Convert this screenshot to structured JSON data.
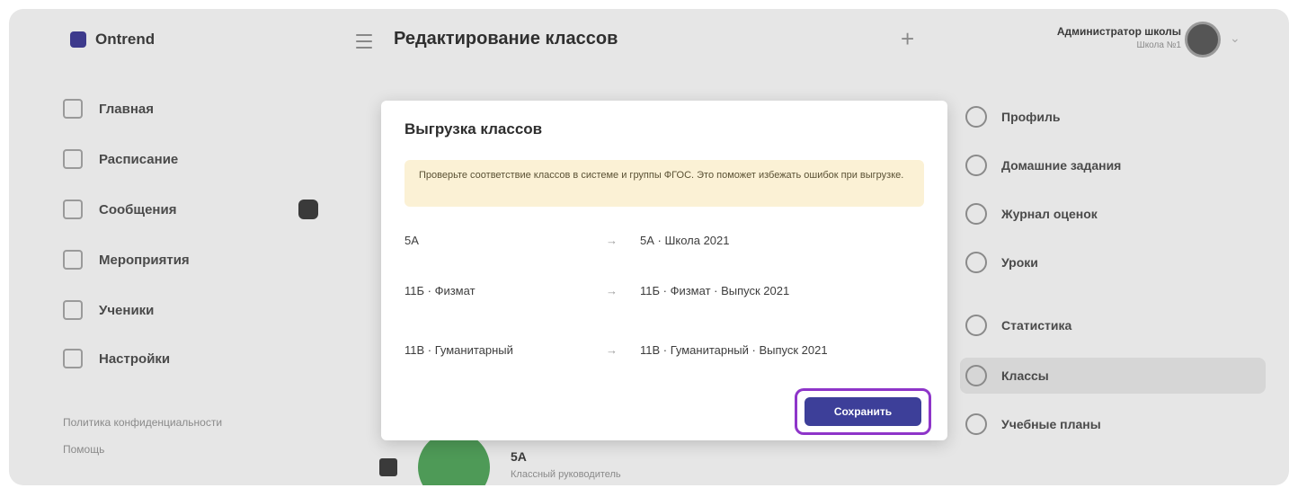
{
  "app": {
    "logo_text": "Ontrend",
    "document_title": "Редактирование классов",
    "user_name": "Администратор школы",
    "user_sub": "Школа №1"
  },
  "sidebar": {
    "items": [
      {
        "label": "Главная",
        "icon": "home-icon"
      },
      {
        "label": "Расписание",
        "icon": "calendar-icon"
      },
      {
        "label": "Сообщения",
        "icon": "message-icon"
      },
      {
        "label": "Мероприятия",
        "icon": "event-icon"
      },
      {
        "label": "Ученики",
        "icon": "students-icon"
      },
      {
        "label": "Настройки",
        "icon": "gear-icon"
      }
    ],
    "footer_line1": "Политика конфиденциальности",
    "footer_line2": "Помощь"
  },
  "right_panel": {
    "items": [
      {
        "label": "Профиль",
        "icon": "user-icon"
      },
      {
        "label": "Домашние задания",
        "icon": "homework-icon"
      },
      {
        "label": "Журнал оценок",
        "icon": "gradebook-icon"
      },
      {
        "label": "Уроки",
        "icon": "clock-icon"
      },
      {
        "label": "Статистика",
        "icon": "chart-icon"
      },
      {
        "label": "Классы",
        "icon": "class-icon"
      },
      {
        "label": "Учебные планы",
        "icon": "plan-icon"
      }
    ]
  },
  "bottom": {
    "label": "5А",
    "sub": "Классный руководитель"
  },
  "modal": {
    "title": "Выгрузка классов",
    "warning": "Проверьте соответствие классов в системе и группы ФГОС. Это поможет избежать ошибок при выгрузке.",
    "mappings": [
      {
        "source": "5А",
        "arrow": "→",
        "target": "5А · Школа 2021"
      },
      {
        "source": "11Б · Физмат",
        "arrow": "→",
        "target": "11Б · Физмат · Выпуск 2021"
      },
      {
        "source": "11В · Гуманитарный",
        "arrow": "→",
        "target": "11В · Гуманитарный · Выпуск 2021"
      }
    ],
    "save_label": "Сохранить"
  },
  "colors": {
    "accent": "#3d3f99",
    "highlight": "#8e35c9",
    "warning_bg": "#fbf1d5"
  }
}
